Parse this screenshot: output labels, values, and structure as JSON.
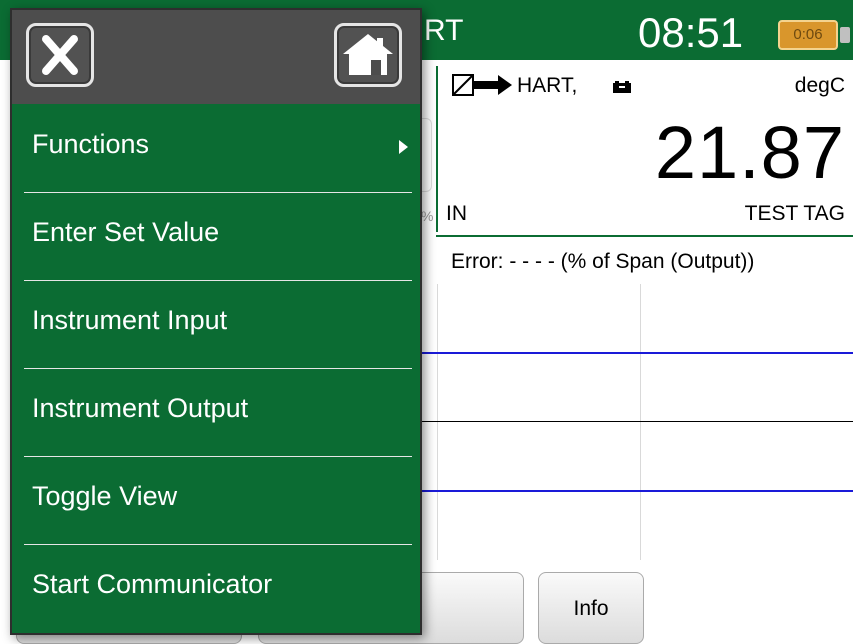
{
  "status_bar": {
    "title_fragment": "RT",
    "time": "08:51",
    "battery_label": "0:06"
  },
  "measurement": {
    "connection": "HART,",
    "unit": "degC",
    "value": "21.87",
    "channel": "IN",
    "tag": "TEST TAG"
  },
  "graph": {
    "error_label": "Error: - - - - (% of Span (Output))"
  },
  "bottom_buttons": {
    "info_label": "Info"
  },
  "menu": {
    "items": [
      {
        "label": "Functions",
        "has_submenu": true
      },
      {
        "label": "Enter Set Value"
      },
      {
        "label": "Instrument Input"
      },
      {
        "label": "Instrument Output"
      },
      {
        "label": "Toggle View"
      },
      {
        "label": "Start Communicator"
      }
    ]
  },
  "colors": {
    "accent_green": "#0b6c33",
    "menu_header": "#4d4d4d",
    "limit_line_blue": "#1a1ad8",
    "battery_orange": "#d9962c"
  },
  "icons": [
    "close-icon",
    "home-icon",
    "submenu-arrow-icon",
    "hart-connection-icon",
    "battery-icon"
  ]
}
